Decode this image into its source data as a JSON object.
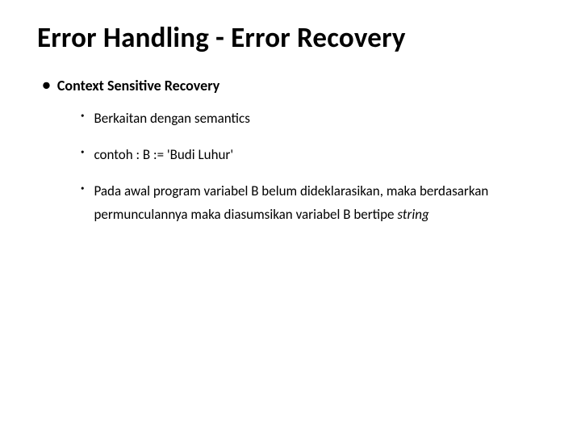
{
  "title": "Error Handling - Error Recovery",
  "level1": {
    "bullet": "●",
    "text": "Context Sensitive Recovery"
  },
  "level2": [
    {
      "bullet": "•",
      "text": "Berkaitan dengan semantics"
    },
    {
      "bullet": "•",
      "text": "contoh  : B := 'Budi Luhur'"
    },
    {
      "bullet": "•",
      "text": "Pada awal program variabel B belum dideklarasikan, maka berdasarkan permunculannya maka diasumsikan variabel B bertipe ",
      "italic_suffix": "string"
    }
  ]
}
